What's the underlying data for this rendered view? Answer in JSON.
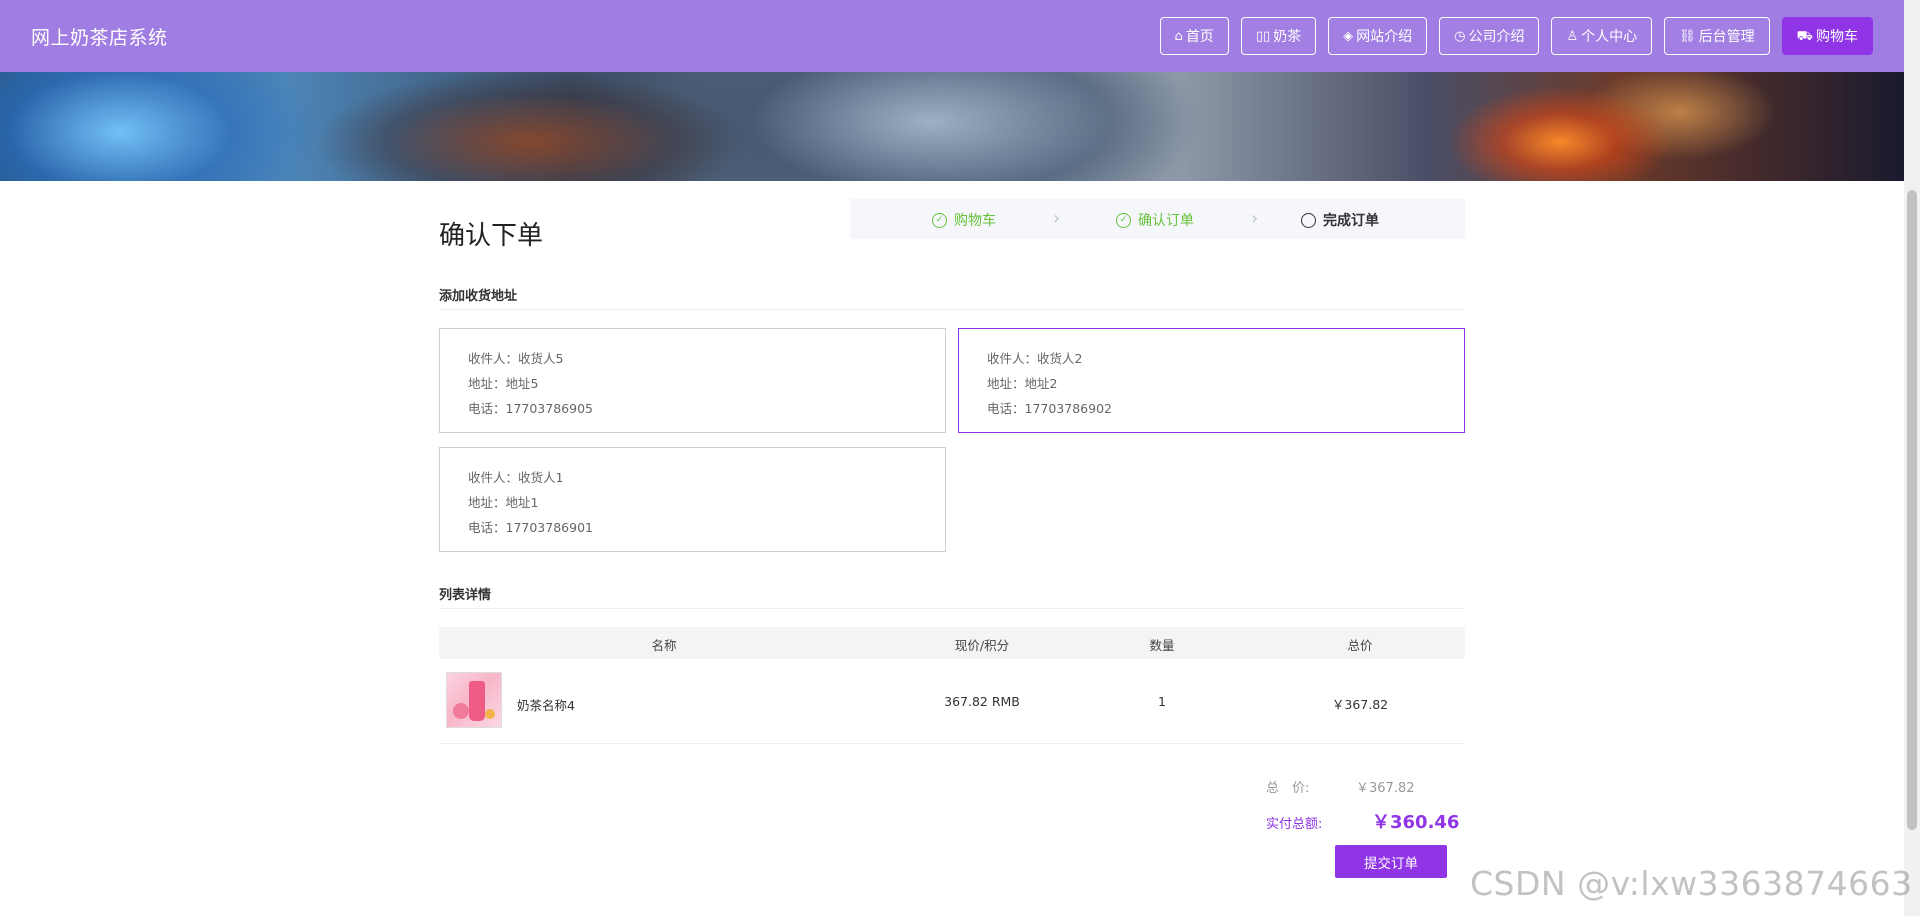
{
  "header": {
    "site_title": "网上奶茶店系统",
    "nav": [
      {
        "label": "首页",
        "icon": "⌂"
      },
      {
        "label": "奶茶",
        "icon": "▯▯"
      },
      {
        "label": "网站介绍",
        "icon": "◈"
      },
      {
        "label": "公司介绍",
        "icon": "◷"
      },
      {
        "label": "个人中心",
        "icon": "♙"
      },
      {
        "label": "后台管理",
        "icon": "⛓"
      },
      {
        "label": "购物车",
        "icon": "⛟"
      }
    ]
  },
  "page": {
    "title": "确认下单"
  },
  "steps": [
    {
      "label": "购物车",
      "status": "done"
    },
    {
      "label": "确认订单",
      "status": "done"
    },
    {
      "label": "完成订单",
      "status": "current"
    }
  ],
  "address_section": {
    "title": "添加收货地址",
    "cards": [
      {
        "recipient": "收件人：收货人5",
        "address": "地址：地址5",
        "phone": "电话：17703786905"
      },
      {
        "recipient": "收件人：收货人2",
        "address": "地址：地址2",
        "phone": "电话：17703786902"
      },
      {
        "recipient": "收件人：收货人1",
        "address": "地址：地址1",
        "phone": "电话：17703786901"
      }
    ]
  },
  "list_section": {
    "title": "列表详情",
    "columns": [
      "名称",
      "现价/积分",
      "数量",
      "总价"
    ],
    "rows": [
      {
        "name": "奶茶名称4",
        "price": "367.82 RMB",
        "qty": "1",
        "total": "￥367.82"
      }
    ]
  },
  "summary": {
    "total_label": "总　价:",
    "total_value": "￥367.82",
    "pay_label": "实付总额:",
    "pay_value": "￥360.46"
  },
  "actions": {
    "submit_label": "提交订单"
  },
  "watermark": "CSDN @v:lxw3363874663",
  "colors": {
    "header_bg": "#a07de3",
    "accent": "#8f35e6",
    "step_done": "#67c23a"
  }
}
